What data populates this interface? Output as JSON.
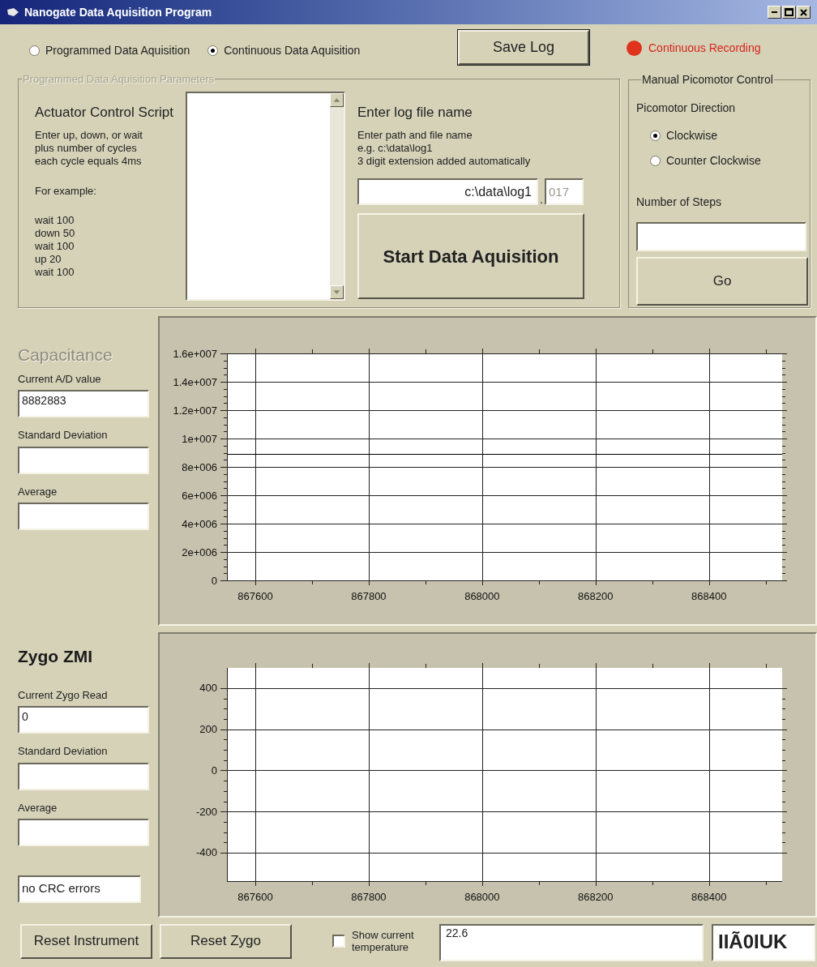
{
  "window": {
    "title": "Nanogate Data Aquisition Program"
  },
  "mode_options": [
    {
      "label": "Programmed Data Aquisition",
      "selected": false
    },
    {
      "label": "Continuous Data Aquisition",
      "selected": true
    }
  ],
  "save_log_button": "Save Log",
  "recording_indicator": {
    "label": "Continuous Recording",
    "on": true
  },
  "programmed_parameters": {
    "title": "Programmed Data Aquisition Parameters",
    "disabled": true,
    "script_heading": "Actuator Control Script",
    "script_help": "Enter up, down, or wait\nplus number of cycles\neach cycle equals 4ms",
    "example_heading": "For example:",
    "example_lines": "wait 100\ndown 50\nwait 100\nup 20\nwait 100",
    "log_heading": "Enter log file name",
    "log_help": "Enter path and file name\ne.g. c:\\data\\log1\n3 digit extension added automatically",
    "log_path": "c:\\data\\log1",
    "extension_separator": ".",
    "extension": "017",
    "start_button": "Start Data Aquisition"
  },
  "picomotor": {
    "title": "Manual Picomotor Control",
    "direction_label": "Picomotor Direction",
    "directions": [
      {
        "label": "Clockwise",
        "selected": true
      },
      {
        "label": "Counter Clockwise",
        "selected": false
      }
    ],
    "steps_label": "Number of Steps",
    "go_button": "Go"
  },
  "panels": [
    {
      "title": "Capacitance",
      "disabled": true,
      "fields": [
        {
          "label": "Current A/D value",
          "value": "8882883"
        },
        {
          "label": "Standard Deviation"
        },
        {
          "label": "Average"
        }
      ],
      "chart_data": {
        "type": "line",
        "x": [
          867550,
          868529
        ],
        "series": [
          {
            "color": "#000000",
            "values": [
              8900000,
              8900000
            ]
          }
        ],
        "grid": true,
        "xlim": [
          867550,
          868529
        ],
        "ylim": [
          0,
          16000000
        ],
        "xticks": [
          867600,
          867800,
          868000,
          868200,
          868400
        ],
        "yticks": [
          {
            "value": 0,
            "label": "0"
          },
          {
            "value": 2000000,
            "label": "2e+006"
          },
          {
            "value": 4000000,
            "label": "4e+006"
          },
          {
            "value": 6000000,
            "label": "6e+006"
          },
          {
            "value": 8000000,
            "label": "8e+006"
          },
          {
            "value": 10000000,
            "label": "1e+007"
          },
          {
            "value": 12000000,
            "label": "1.2e+007"
          },
          {
            "value": 14000000,
            "label": "1.4e+007"
          },
          {
            "value": 16000000,
            "label": "1.6e+007"
          }
        ]
      }
    },
    {
      "title": "Zygo ZMI",
      "disabled": false,
      "fields": [
        {
          "label": "Current Zygo Read",
          "value": "0"
        },
        {
          "label": "Standard Deviation"
        },
        {
          "label": "Average"
        }
      ],
      "status_field": "no CRC errors",
      "chart_data": {
        "type": "line",
        "grid": true,
        "xlim": [
          867550,
          868529
        ],
        "ylim": [
          -538,
          498
        ],
        "xticks": [
          867600,
          867800,
          868000,
          868200,
          868400
        ],
        "yticks": [
          -400,
          -200,
          0,
          200,
          400
        ]
      }
    }
  ],
  "bottom_bar": {
    "buttons": [
      "Reset Instrument",
      "Reset Zygo"
    ],
    "temperature_checkbox": {
      "label": "Show current temperature",
      "checked": false
    },
    "temperature_field": "22.6",
    "code_field": "IIÃ0IUK"
  }
}
